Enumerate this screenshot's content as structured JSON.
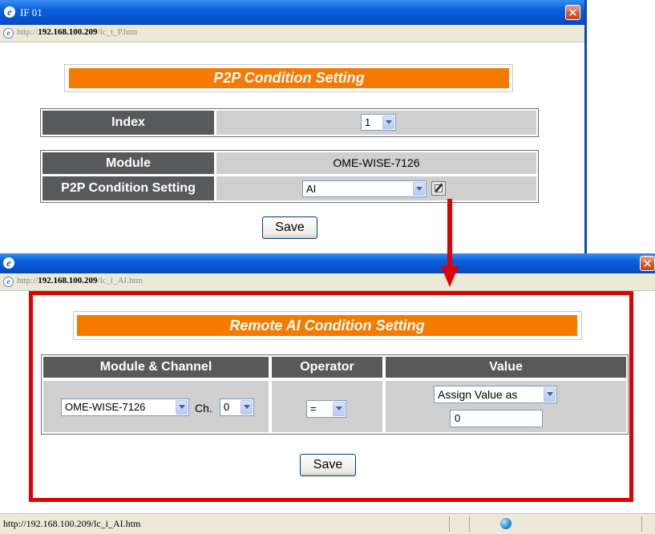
{
  "window1": {
    "title": "IF 01",
    "address": "http://192.168.100.209/lc_t_P.htm",
    "address_prefix": "http://",
    "address_host": "192.168.100.209",
    "address_path": "/lc_t_P.htm",
    "banner": "P2P Condition Setting",
    "index_label": "Index",
    "index_value": "1",
    "module_label": "Module",
    "module_value": "OME-WISE-7126",
    "condition_label": "P2P Condition Setting",
    "condition_value": "AI",
    "save_label": "Save"
  },
  "window2": {
    "address_prefix": "http://",
    "address_host": "192.168.100.209",
    "address_path": "/lc_i_AI.htm",
    "banner": "Remote AI Condition Setting",
    "headers": [
      "Module & Channel",
      "Operator",
      "Value"
    ],
    "module_select": "OME-WISE-7126",
    "channel_label": "Ch.",
    "channel_select": "0",
    "operator_select": "=",
    "value_mode_select": "Assign Value as",
    "value_input": "0",
    "save_label": "Save"
  },
  "statusbar": {
    "url": "http://192.168.100.209/lc_i_AI.htm"
  },
  "colors": {
    "banner": "#f47a00",
    "header_cell": "#58595b",
    "value_cell": "#cfcfcf",
    "highlight": "#e00000",
    "xp_title": "#0a5fd8"
  },
  "icons": [
    "ie-logo-icon",
    "close-icon",
    "dropdown-arrow-icon",
    "edit-icon",
    "internet-zone-icon"
  ]
}
